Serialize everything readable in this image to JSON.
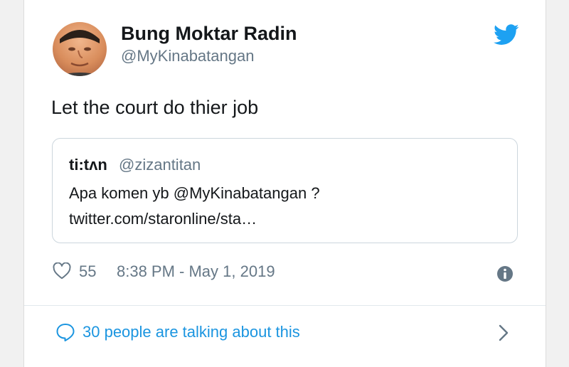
{
  "tweet": {
    "display_name": "Bung Moktar Radin",
    "handle": "@MyKinabatangan",
    "text": "Let the court do thier job",
    "quoted": {
      "display_name": "ti:tʌn",
      "handle": "@zizantitan",
      "line1": "Apa komen yb @MyKinabatangan ?",
      "line2": "twitter.com/staronline/sta…"
    },
    "likes": "55",
    "timestamp": "8:38 PM - May 1, 2019",
    "talking_link": "30 people are talking about this"
  },
  "colors": {
    "twitter_blue": "#1da1f2",
    "link_blue": "#1b95e0",
    "secondary_text": "#657786",
    "border": "#ccd6dd"
  },
  "icons": [
    "twitter-bird-icon",
    "heart-icon",
    "info-icon",
    "speech-bubble-icon",
    "chevron-right-icon"
  ]
}
